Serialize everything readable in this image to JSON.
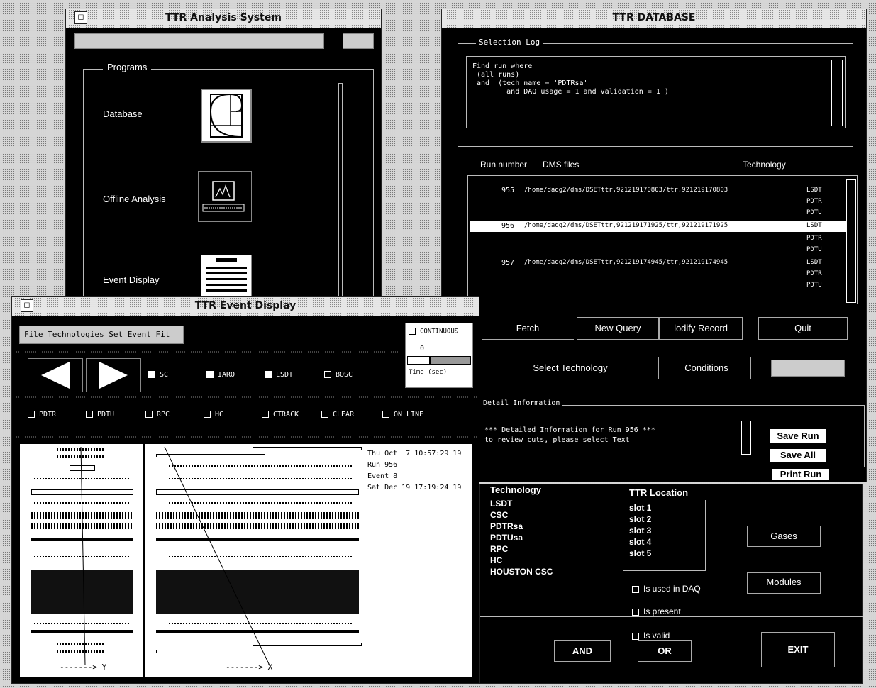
{
  "analysis_window": {
    "title": "TTR Analysis System",
    "programs_label": "Programs",
    "programs": [
      {
        "label": "Database",
        "icon": "golden-spiral-icon"
      },
      {
        "label": "Offline Analysis",
        "icon": "computer-monitor-icon"
      },
      {
        "label": "Event Display",
        "icon": "document-icon"
      }
    ]
  },
  "database_window": {
    "title": "TTR DATABASE",
    "selection_log_label": "Selection Log",
    "query_lines": [
      "Find run where",
      " (all runs)",
      " and  (tech name = 'PDTRsa'",
      "        and DAQ usage = 1 and validation = 1 )"
    ],
    "columns": {
      "run": "Run number",
      "files": "DMS files",
      "tech": "Technology"
    },
    "runs": [
      {
        "run": "955",
        "file": "/home/daqg2/dms/DSETttr,921219170803/ttr,921219170803",
        "techs": [
          "LSDT",
          "PDTR",
          "PDTU"
        ],
        "selected": false
      },
      {
        "run": "956",
        "file": "/home/daqg2/dms/DSETttr,921219171925/ttr,921219171925",
        "techs": [
          "LSDT",
          "PDTR",
          "PDTU"
        ],
        "selected": true
      },
      {
        "run": "957",
        "file": "/home/daqg2/dms/DSETttr,921219174945/ttr,921219174945",
        "techs": [
          "LSDT",
          "PDTR",
          "PDTU"
        ],
        "selected": false
      }
    ],
    "buttons": {
      "fetch": "Fetch",
      "new_query": "New Query",
      "modify": "lodify Record",
      "quit": "Quit",
      "select_tech": "Select Technology",
      "conditions": "Conditions",
      "save_run": "Save Run",
      "save_all": "Save All",
      "print_run": "Print Run"
    },
    "detail_label": "Detail Information",
    "detail_lines": [
      "*** Detailed Information for Run 956 ***",
      "to review cuts, please select Text"
    ]
  },
  "tech_panel": {
    "tech_label": "Technology",
    "techs": [
      "LSDT",
      "CSC",
      "PDTRsa",
      "PDTUsa",
      "RPC",
      "HC",
      "HOUSTON CSC"
    ],
    "location_label": "TTR Location",
    "slots": [
      "slot 1",
      "slot 2",
      "slot 3",
      "slot 4",
      "slot 5"
    ],
    "gases": "Gases",
    "modules": "Modules",
    "is_used": "Is used in DAQ",
    "is_present": "Is present",
    "is_valid": "Is valid",
    "and": "AND",
    "or": "OR",
    "exit": "EXIT"
  },
  "event_window": {
    "title": "TTR Event Display",
    "menu": [
      "File",
      "Technologies",
      "Set",
      "Event",
      "Fit"
    ],
    "continuous": "CONTINUOUS",
    "slider_value": "0",
    "time_label": "Time (sec)",
    "row1_toggles": [
      {
        "label": "SC",
        "on": true
      },
      {
        "label": "IARO",
        "on": true
      },
      {
        "label": "LSDT",
        "on": true
      },
      {
        "label": "BOSC",
        "on": false
      }
    ],
    "row2_toggles": [
      {
        "label": "PDTR",
        "on": false
      },
      {
        "label": "PDTU",
        "on": false
      },
      {
        "label": "RPC",
        "on": false
      },
      {
        "label": "HC",
        "on": false
      },
      {
        "label": "CTRACK",
        "on": false
      },
      {
        "label": "CLEAR",
        "on": false
      },
      {
        "label": "ON LINE",
        "on": false
      }
    ],
    "info_lines": [
      "Thu Oct  7 10:57:29 19",
      "Run 956",
      "Event 8",
      "Sat Dec 19 17:19:24 19"
    ],
    "axis_y": "Y",
    "axis_x": "X"
  }
}
